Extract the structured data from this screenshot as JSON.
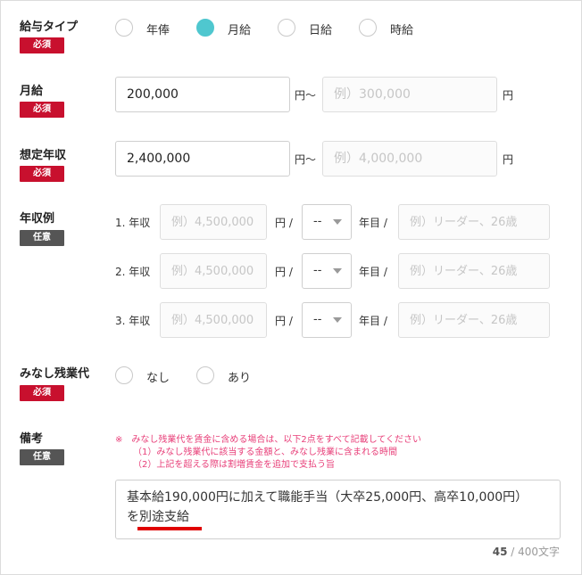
{
  "required_label": "必須",
  "optional_label": "任意",
  "salary_type": {
    "label": "給与タイプ",
    "options": [
      {
        "label": "年俸",
        "selected": false
      },
      {
        "label": "月給",
        "selected": true
      },
      {
        "label": "日給",
        "selected": false
      },
      {
        "label": "時給",
        "selected": false
      }
    ]
  },
  "monthly": {
    "label": "月給",
    "min_value": "200,000",
    "max_placeholder": "例）300,000",
    "unit_range": "円〜",
    "unit": "円"
  },
  "annual": {
    "label": "想定年収",
    "min_value": "2,400,000",
    "max_placeholder": "例）4,000,000",
    "unit_range": "円〜",
    "unit": "円"
  },
  "examples": {
    "label": "年収例",
    "rows": [
      {
        "prefix": "1. 年収",
        "income_placeholder": "例）4,500,000",
        "unit": "円 /",
        "year": "--",
        "year_unit": "年目 /",
        "who_placeholder": "例）リーダー、26歳"
      },
      {
        "prefix": "2. 年収",
        "income_placeholder": "例）4,500,000",
        "unit": "円 /",
        "year": "--",
        "year_unit": "年目 /",
        "who_placeholder": "例）リーダー、26歳"
      },
      {
        "prefix": "3. 年収",
        "income_placeholder": "例）4,500,000",
        "unit": "円 /",
        "year": "--",
        "year_unit": "年目 /",
        "who_placeholder": "例）リーダー、26歳"
      }
    ]
  },
  "overtime": {
    "label": "みなし残業代",
    "options": [
      {
        "label": "なし",
        "selected": false
      },
      {
        "label": "あり",
        "selected": false
      }
    ]
  },
  "remarks": {
    "label": "備考",
    "notes": [
      "※　みなし残業代を賃金に含める場合は、以下2点をすべて記載してください",
      "（1）みなし残業代に該当する金額と、みなし残業に含まれる時間",
      "（2）上記を超える際は割増賃金を追加で支払う旨"
    ],
    "text_line1": "基本給190,000円に加えて職能手当（大卒25,000円、高卒10,000円）",
    "text_line2": "を別途支給",
    "count": "45",
    "count_sep": " / ",
    "count_max": "400文字"
  }
}
